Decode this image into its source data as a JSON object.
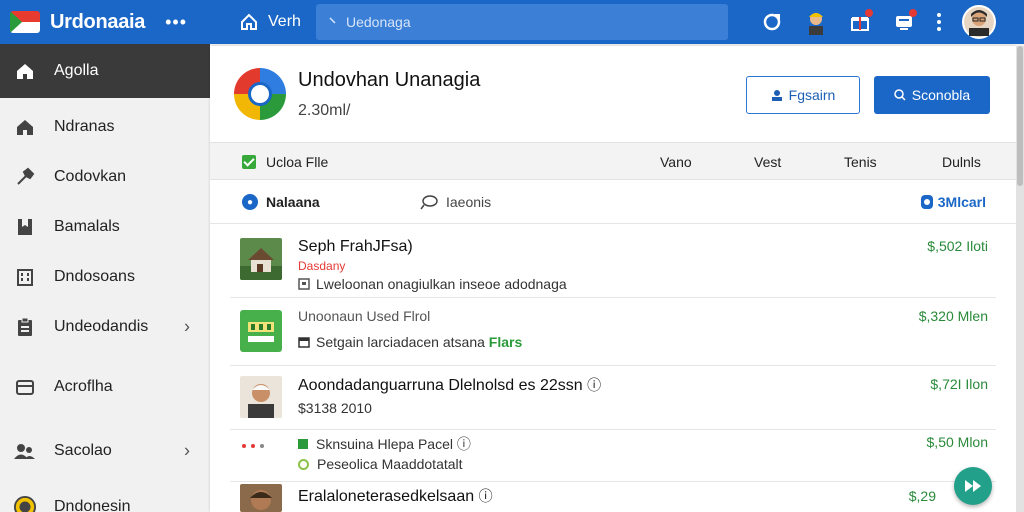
{
  "topbar": {
    "brand": "Urdonaaia",
    "more": "•••",
    "home_label": "Verh",
    "search_placeholder": "Uedonaga"
  },
  "sidebar": {
    "items": [
      {
        "label": "Agolla",
        "icon": "home-icon",
        "active": true
      },
      {
        "label": "Ndranas",
        "icon": "home-outline-icon"
      },
      {
        "label": "Codovkan",
        "icon": "wrench-icon"
      },
      {
        "label": "Bamalals",
        "icon": "bookmark-icon"
      },
      {
        "label": "Dndosoans",
        "icon": "building-icon"
      },
      {
        "label": "Undeodandis",
        "icon": "clipboard-icon",
        "chevron": true
      },
      {
        "label": "Acroflha",
        "icon": "folder-icon"
      },
      {
        "label": "Sacolao",
        "icon": "people-icon",
        "chevron": true
      },
      {
        "label": "Dndonesin",
        "icon": "coin-icon"
      }
    ]
  },
  "header": {
    "title": "Undovhan Unanagia",
    "subtitle": "2.30ml/",
    "btn_outline": "Fgsairn",
    "btn_solid": "Sconobla"
  },
  "columns": {
    "select_label": "Ucloa Flle",
    "col1": "Vano",
    "col2": "Vest",
    "col3": "Tenis",
    "col4": "Dulnls"
  },
  "filters": {
    "f1": "Nalaana",
    "f2": "Iaeonis",
    "f3": "3Mlcarl"
  },
  "rows": [
    {
      "title": "Seph FrahJFsa)",
      "sub": "Dasdany",
      "line": "Lweloonan onagiulkan inseoe adodnaga",
      "price": "$,502 Iloti"
    },
    {
      "title": "Unoonaun Used Flrol",
      "line": "Setgain larciadacen atsana",
      "line_green": "Flars",
      "price": "$,320 Mlen"
    },
    {
      "title": "Aoondadanguarruna Dlelnolsd es 22ssn",
      "line": "$3138 2010",
      "price": "$,72I Ilon"
    },
    {
      "title": "Sknsuina Hlepa Pacel",
      "line": "Peseolica Maaddotatalt",
      "price": "$,50 Mlon"
    },
    {
      "title": "Eralaloneterasedkelsaan",
      "price": "$,29"
    }
  ],
  "colors": {
    "topbar": "#1a67c7",
    "sidebar_active": "#3a3a3a",
    "price": "#2a8a3a",
    "fab": "#23a08a"
  }
}
